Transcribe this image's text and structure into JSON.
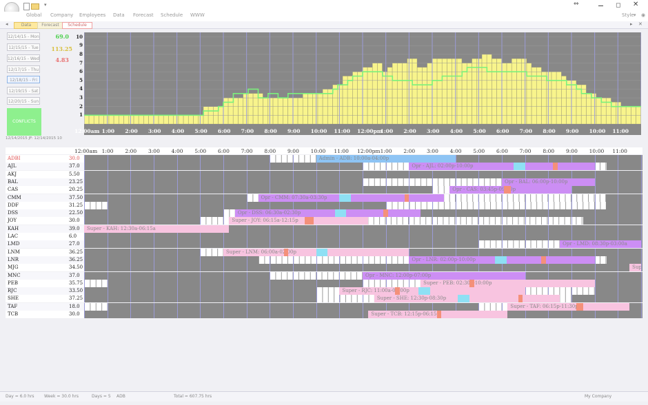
{
  "menu": [
    "Global",
    "Company",
    "Employees",
    "Data",
    "Forecast",
    "Schedule",
    "WWW"
  ],
  "window": {
    "style_label": "Style"
  },
  "tabs": [
    "Data",
    "Forecast",
    "Schedule"
  ],
  "days": [
    "12/14/15 - Mon",
    "12/15/15 - Tue",
    "12/16/15 - Wed",
    "12/17/15 - Thu",
    "12/18/15 - Fri",
    "12/19/15 - Sat",
    "12/20/15 - Sun"
  ],
  "selected_day": 4,
  "conflicts_label": "CONFLICTS",
  "stats": {
    "top": "69.0",
    "mid": "113.25",
    "low": "4.83"
  },
  "info": "12/14/2015  JF: 12/14/2015 10",
  "chart_data": {
    "type": "bar",
    "ylim": [
      0,
      10
    ],
    "yticks": [
      1,
      2,
      3,
      4,
      5,
      6,
      7,
      8,
      9,
      10
    ],
    "xticks": [
      "12:00am",
      "1:00",
      "2:00",
      "3:00",
      "4:00",
      "5:00",
      "6:00",
      "7:00",
      "8:00",
      "9:00",
      "10:00",
      "11:00",
      "12:00pm",
      "1:00",
      "2:00",
      "3:00",
      "4:00",
      "5:00",
      "6:00",
      "7:00",
      "8:00",
      "9:00",
      "10:00",
      "11:00"
    ],
    "series": [
      {
        "kind": "bar",
        "color": "#f8f48c",
        "values": [
          1.0,
          1.0,
          1.0,
          1.0,
          1.0,
          1.0,
          1.0,
          1.0,
          1.0,
          1.0,
          1.0,
          1.0,
          1.0,
          1.0,
          1.0,
          1.0,
          1.0,
          1.0,
          1.0,
          1.0,
          1.0,
          1.0,
          1.0,
          1.0,
          2.0,
          2.0,
          2.0,
          2.0,
          3.0,
          3.0,
          3.0,
          3.0,
          3.5,
          3.5,
          3.5,
          3.5,
          3.0,
          3.0,
          3.0,
          3.0,
          3.0,
          3.0,
          3.0,
          3.0,
          3.5,
          3.5,
          3.5,
          3.5,
          4.0,
          4.0,
          4.5,
          4.5,
          5.5,
          5.5,
          6.0,
          6.0,
          6.5,
          6.5,
          7.0,
          7.0,
          6.0,
          6.5,
          7.0,
          7.0,
          7.0,
          7.5,
          7.5,
          6.5,
          6.5,
          7.0,
          7.5,
          7.5,
          7.5,
          7.5,
          7.5,
          7.5,
          7.0,
          7.0,
          7.5,
          7.5,
          8.0,
          8.0,
          7.5,
          7.5,
          7.0,
          7.0,
          7.5,
          7.5,
          7.5,
          7.0,
          6.5,
          6.5,
          6.0,
          6.0,
          6.0,
          6.0,
          5.5,
          5.0,
          5.0,
          4.5,
          4.5,
          3.5,
          3.5,
          3.0,
          3.0,
          3.0,
          2.5,
          2.5,
          2.0,
          2.0,
          2.0,
          2.0
        ]
      },
      {
        "kind": "line",
        "color": "#7cf07c",
        "values": [
          1.0,
          1.0,
          1.0,
          1.0,
          1.0,
          1.0,
          1.0,
          1.0,
          1.0,
          1.0,
          1.0,
          1.0,
          1.0,
          1.0,
          1.0,
          1.0,
          1.0,
          1.0,
          1.0,
          1.0,
          1.0,
          1.0,
          1.0,
          1.0,
          1.5,
          1.5,
          1.5,
          2.0,
          2.5,
          2.5,
          3.5,
          3.5,
          3.5,
          4.0,
          4.0,
          3.0,
          3.0,
          3.5,
          3.5,
          3.0,
          3.0,
          3.5,
          3.5,
          3.5,
          3.5,
          3.5,
          3.5,
          3.5,
          3.5,
          3.5,
          4.0,
          4.5,
          4.5,
          5.0,
          5.5,
          5.5,
          6.0,
          6.0,
          6.0,
          6.0,
          5.5,
          5.5,
          5.0,
          5.0,
          5.0,
          5.0,
          4.5,
          4.5,
          4.5,
          4.5,
          5.0,
          5.0,
          5.5,
          5.5,
          5.5,
          5.5,
          6.0,
          6.5,
          6.5,
          6.5,
          6.5,
          6.0,
          6.0,
          6.0,
          6.0,
          6.0,
          6.0,
          6.0,
          6.0,
          5.5,
          5.5,
          5.5,
          5.5,
          5.0,
          5.0,
          5.0,
          5.0,
          4.5,
          4.5,
          4.0,
          3.5,
          3.5,
          3.0,
          3.0,
          2.5,
          2.5,
          2.0,
          2.0,
          2.0,
          2.0,
          2.0,
          2.0
        ]
      }
    ]
  },
  "schedule_hours": [
    "12:00am",
    "1:00",
    "2:00",
    "3:00",
    "4:00",
    "5:00",
    "6:00",
    "7:00",
    "8:00",
    "9:00",
    "10:00",
    "11:00",
    "12:00pm",
    "1:00",
    "2:00",
    "3:00",
    "4:00",
    "5:00",
    "6:00",
    "7:00",
    "8:00",
    "9:00",
    "10:00",
    "11:00"
  ],
  "rows": [
    {
      "name": "ADBI",
      "hours": "30.0",
      "highlight": true,
      "avail": [
        [
          8,
          16
        ]
      ],
      "shift": {
        "label": "Admin - ADB: 10:00a-04:00p",
        "start": 10,
        "end": 16,
        "color": "#8ec4f4"
      },
      "blue": [],
      "red": []
    },
    {
      "name": "AJL",
      "hours": "37.0",
      "avail": [
        [
          12,
          22.5
        ]
      ],
      "shift": {
        "label": "Opr - AJL: 02:00p-10:00p",
        "start": 14,
        "end": 22,
        "color": "#cc8ef4"
      },
      "blue": [
        [
          18.5,
          19
        ]
      ],
      "red": [
        [
          20.2,
          20.4
        ]
      ]
    },
    {
      "name": "AKJ",
      "hours": "5.50",
      "avail": [],
      "shift": null,
      "blue": [],
      "red": []
    },
    {
      "name": "BAL",
      "hours": "23.25",
      "avail": [
        [
          12,
          22
        ]
      ],
      "shift": {
        "label": "Opr - BAL: 06:00p-10:00p",
        "start": 18,
        "end": 22,
        "color": "#cc8ef4"
      },
      "blue": [],
      "red": []
    },
    {
      "name": "CAS",
      "hours": "20.25",
      "avail": [
        [
          15,
          21
        ]
      ],
      "shift": {
        "label": "Opr - CAS: 03:45p-09:00p",
        "start": 15.75,
        "end": 21,
        "color": "#cc8ef4"
      },
      "blue": [],
      "red": [
        [
          18.1,
          18.4
        ]
      ]
    },
    {
      "name": "CMM",
      "hours": "37.50",
      "avail": [
        [
          7,
          22.5
        ]
      ],
      "shift": {
        "label": "Opr - CMM: 07:30a-03:30p",
        "start": 7.5,
        "end": 15.5,
        "color": "#cc8ef4"
      },
      "blue": [
        [
          11,
          11.5
        ]
      ],
      "red": [
        [
          13.8,
          14
        ]
      ]
    },
    {
      "name": "DDF",
      "hours": "31.25",
      "avail": [
        [
          0,
          1
        ],
        [
          13,
          22.5
        ]
      ],
      "shift": null,
      "blue": [],
      "red": []
    },
    {
      "name": "DSS",
      "hours": "22.50",
      "avail": [
        [
          6,
          14.5
        ]
      ],
      "shift": {
        "label": "Opr - DSS: 06:30a-02:30p",
        "start": 6.5,
        "end": 14.5,
        "color": "#cc8ef4"
      },
      "blue": [
        [
          10.8,
          11.3
        ]
      ],
      "red": [
        [
          12.9,
          13.1
        ]
      ]
    },
    {
      "name": "JOY",
      "hours": "30.0",
      "avail": [
        [
          5,
          21.5
        ]
      ],
      "shift": {
        "label": "Super - JOY: 06:15a-12:15p",
        "start": 6.25,
        "end": 12.25,
        "color": "#f8c4e0"
      },
      "blue": [],
      "red": [
        [
          9.5,
          9.9
        ]
      ]
    },
    {
      "name": "KAH",
      "hours": "39.0",
      "avail": [],
      "shift": {
        "label": "Super - KAH: 12:30a-06:15a",
        "start": 0,
        "end": 6.25,
        "color": "#f8c4e0"
      },
      "blue": [],
      "red": []
    },
    {
      "name": "LAC",
      "hours": "6.0",
      "avail": [],
      "shift": null,
      "blue": [],
      "red": []
    },
    {
      "name": "LMD",
      "hours": "27.0",
      "avail": [
        [
          17,
          24
        ]
      ],
      "shift": {
        "label": "Opr - LMD: 08:30p-03:00a",
        "start": 20.5,
        "end": 24,
        "color": "#cc8ef4"
      },
      "blue": [],
      "red": []
    },
    {
      "name": "LNM",
      "hours": "36.25",
      "avail": [
        [
          5,
          13
        ]
      ],
      "shift": {
        "label": "Super - LNM: 06:00a-02:00p",
        "start": 6,
        "end": 14,
        "color": "#f8c4e0"
      },
      "blue": [
        [
          10,
          10.5
        ]
      ],
      "red": [
        [
          8.6,
          8.8
        ]
      ]
    },
    {
      "name": "LNR",
      "hours": "36.25",
      "avail": [
        [
          7.5,
          22.5
        ]
      ],
      "shift": {
        "label": "Opr - LNR: 02:00p-10:00p",
        "start": 14,
        "end": 22,
        "color": "#cc8ef4"
      },
      "blue": [
        [
          17.7,
          18.2
        ]
      ],
      "red": [
        [
          19.7,
          19.9
        ]
      ]
    },
    {
      "name": "MJG",
      "hours": "34.50",
      "avail": [],
      "shift": {
        "label": "Super",
        "start": 23.5,
        "end": 24,
        "color": "#f8c4e0"
      },
      "blue": [],
      "red": []
    },
    {
      "name": "MNC",
      "hours": "37.0",
      "avail": [
        [
          8,
          16
        ]
      ],
      "shift": {
        "label": "Opr - MNC: 12:00p-07:00p",
        "start": 12,
        "end": 19,
        "color": "#cc8ef4"
      },
      "blue": [],
      "red": []
    },
    {
      "name": "PEB",
      "hours": "35.75",
      "avail": [
        [
          0,
          1
        ],
        [
          12,
          22
        ]
      ],
      "shift": {
        "label": "Super - PEB: 02:30p-10:00p",
        "start": 14.5,
        "end": 22,
        "color": "#f8c4e0"
      },
      "blue": [],
      "red": [
        [
          16.6,
          16.8
        ]
      ]
    },
    {
      "name": "RJC",
      "hours": "33.50",
      "avail": [
        [
          10,
          22
        ]
      ],
      "shift": {
        "label": "Super - RJC: 11:00a-07:00p",
        "start": 11,
        "end": 19,
        "color": "#f8c4e0"
      },
      "blue": [
        [
          14.4,
          14.9
        ]
      ],
      "red": [
        [
          13.4,
          13.6
        ]
      ]
    },
    {
      "name": "SHE",
      "hours": "37.25",
      "avail": [
        [
          10,
          21
        ]
      ],
      "shift": {
        "label": "Super - SHE: 12:30p-08:30p",
        "start": 12.5,
        "end": 20.5,
        "color": "#f8c4e0"
      },
      "blue": [
        [
          16.1,
          16.6
        ]
      ],
      "red": [
        [
          18.7,
          18.9
        ]
      ]
    },
    {
      "name": "TAF",
      "hours": "18.0",
      "avail": [
        [
          0,
          1
        ],
        [
          17,
          22.5
        ]
      ],
      "shift": {
        "label": "Super - TAF: 06:15p-11:30p",
        "start": 18.25,
        "end": 23.5,
        "color": "#f8c4e0"
      },
      "blue": [],
      "red": [
        [
          21.2,
          21.5
        ]
      ]
    },
    {
      "name": "TCB",
      "hours": "30.0",
      "avail": [],
      "shift": {
        "label": "Super - TCB: 12:15p-06:15p",
        "start": 12.25,
        "end": 18.25,
        "color": "#f8c4e0"
      },
      "blue": [],
      "red": [
        [
          15.2,
          15.4
        ]
      ]
    }
  ],
  "status": {
    "day": "Day = 6.0 hrs",
    "week": "Week = 30.0 hrs",
    "days": "Days = 5",
    "emp": "ADB",
    "total": "Total = 607.75 hrs",
    "company": "My Company"
  }
}
